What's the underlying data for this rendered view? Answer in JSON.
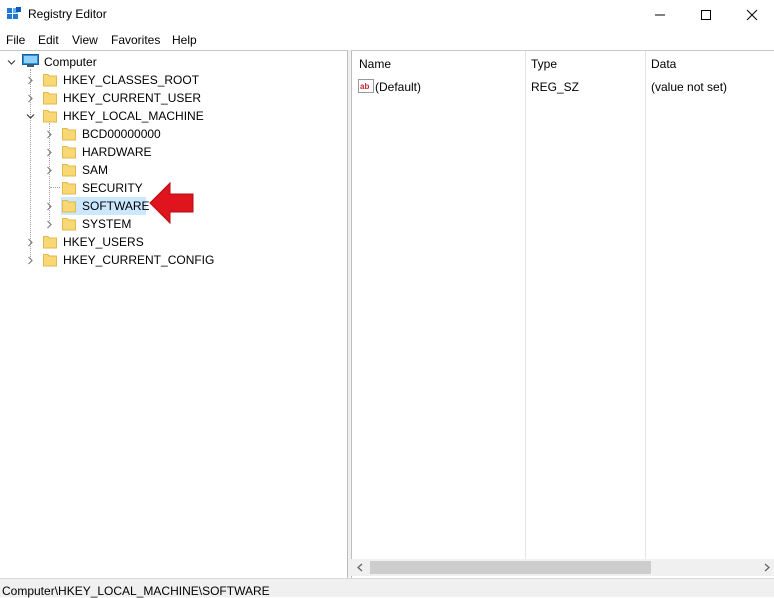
{
  "window": {
    "title": "Registry Editor"
  },
  "menu": [
    "File",
    "Edit",
    "View",
    "Favorites",
    "Help"
  ],
  "tree": {
    "root": "Computer",
    "hives": [
      "HKEY_CLASSES_ROOT",
      "HKEY_CURRENT_USER",
      "HKEY_LOCAL_MACHINE",
      "HKEY_USERS",
      "HKEY_CURRENT_CONFIG"
    ],
    "hklm_children": [
      "BCD00000000",
      "HARDWARE",
      "SAM",
      "SECURITY",
      "SOFTWARE",
      "SYSTEM"
    ],
    "selected": "SOFTWARE"
  },
  "list": {
    "columns": [
      "Name",
      "Type",
      "Data"
    ],
    "rows": [
      {
        "name": "(Default)",
        "type": "REG_SZ",
        "data": "(value not set)"
      }
    ]
  },
  "status": {
    "path": "Computer\\HKEY_LOCAL_MACHINE\\SOFTWARE"
  },
  "colors": {
    "folder": "#f8d775",
    "folder_edge": "#e2b94c",
    "selection": "#cce8ff",
    "annotation_arrow": "#e0141c"
  }
}
